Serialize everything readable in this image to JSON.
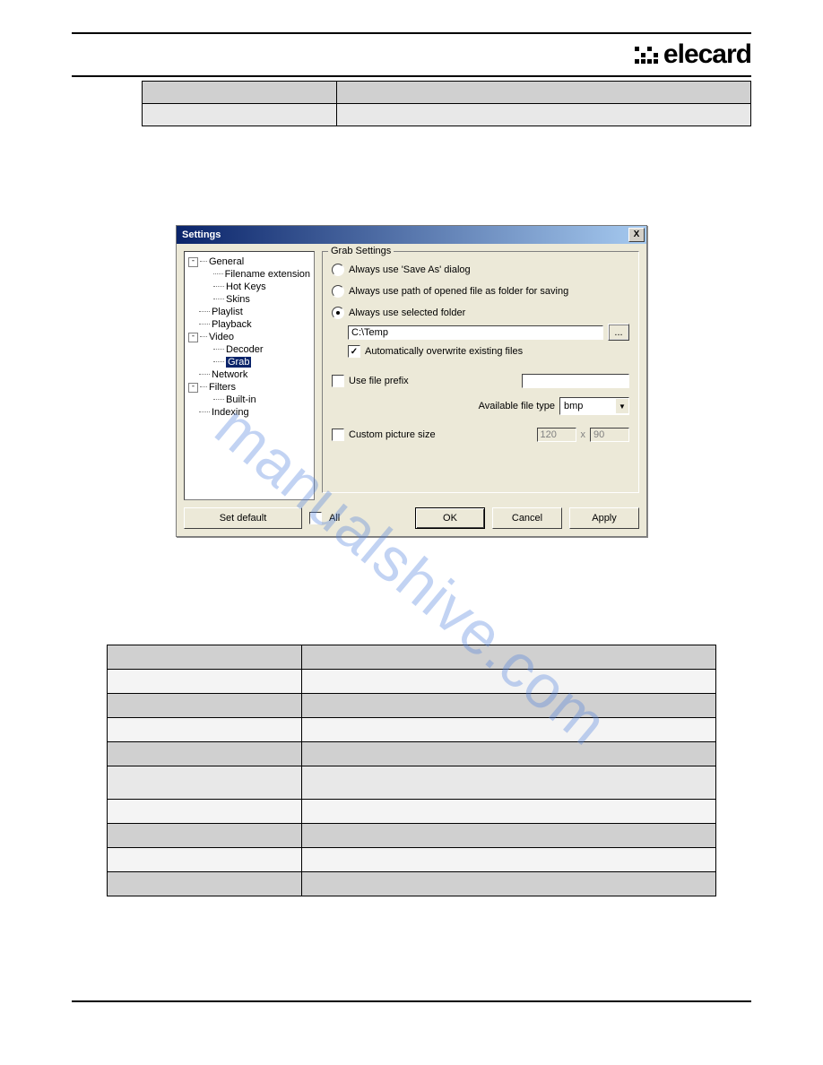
{
  "watermark": "manualshive.com",
  "dialog": {
    "title": "Settings",
    "tree": {
      "general": "General",
      "filename_ext": "Filename extension",
      "hot_keys": "Hot Keys",
      "skins": "Skins",
      "playlist": "Playlist",
      "playback": "Playback",
      "video": "Video",
      "decoder": "Decoder",
      "grab": "Grab",
      "network": "Network",
      "filters": "Filters",
      "builtin": "Built-in",
      "indexing": "Indexing"
    },
    "group_label": "Grab Settings",
    "radio_saveas": "Always use 'Save As' dialog",
    "radio_path": "Always use path of opened file as folder for saving",
    "radio_selected": "Always use selected folder",
    "folder_path": "C:\\Temp",
    "browse": "...",
    "overwrite": "Automatically overwrite existing files",
    "use_prefix": "Use file prefix",
    "available_type": "Available file type",
    "filetype_value": "bmp",
    "custom_size": "Custom picture size",
    "width": "120",
    "x": "x",
    "height": "90",
    "set_default": "Set default",
    "all": "All",
    "ok": "OK",
    "cancel": "Cancel",
    "apply": "Apply"
  },
  "lower_rows": [
    {
      "a": "",
      "b": "",
      "bg": "d"
    },
    {
      "a": "",
      "b": "",
      "bg": "f"
    },
    {
      "a": "",
      "b": "",
      "bg": "d"
    },
    {
      "a": "",
      "b": "",
      "bg": "f"
    },
    {
      "a": "",
      "b": "",
      "bg": "d"
    },
    {
      "a": "",
      "b": "",
      "bg": "e"
    },
    {
      "a": "",
      "b": "",
      "bg": "f"
    },
    {
      "a": "",
      "b": "",
      "bg": "d"
    },
    {
      "a": "",
      "b": "",
      "bg": "f"
    },
    {
      "a": "",
      "b": "",
      "bg": "d"
    }
  ]
}
